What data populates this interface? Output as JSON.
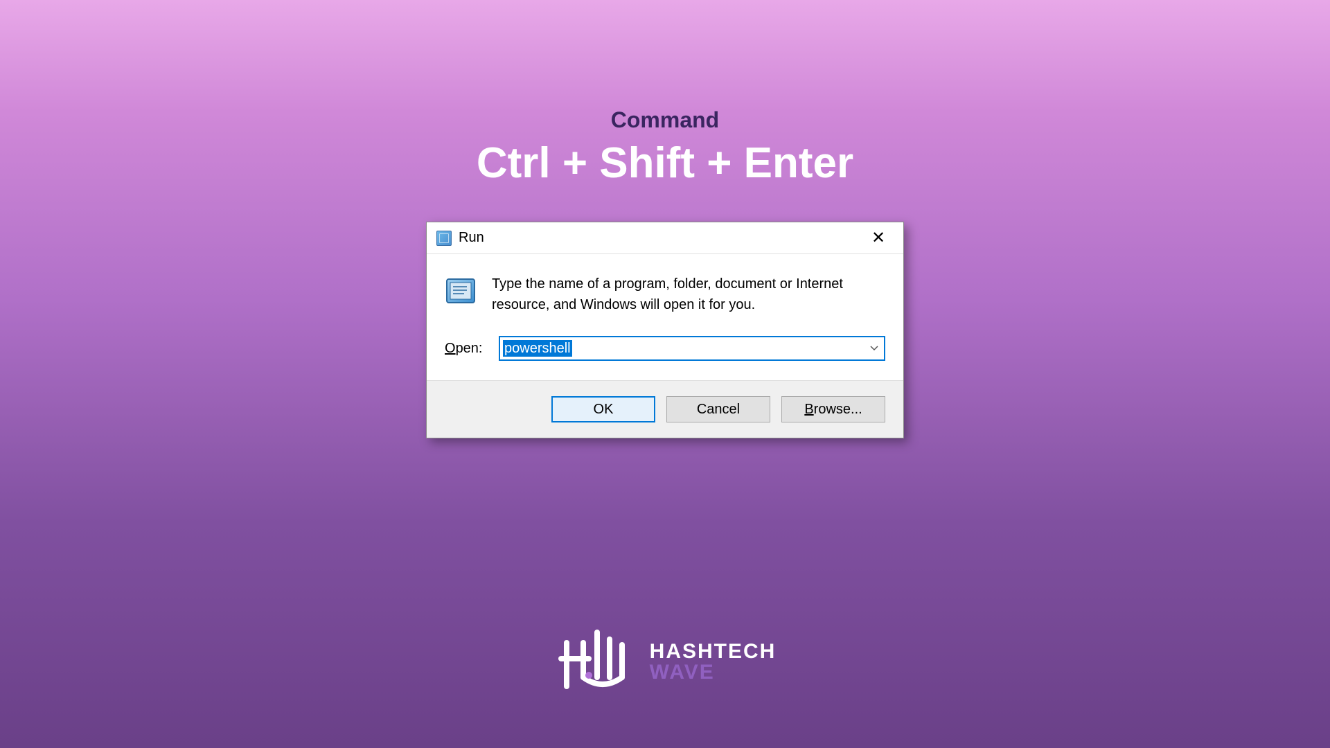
{
  "header": {
    "label": "Command",
    "keys": "Ctrl + Shift + Enter"
  },
  "dialog": {
    "title": "Run",
    "description": "Type the name of a program, folder, document or Internet resource, and Windows will open it for you.",
    "open_label_underline": "O",
    "open_label_rest": "pen:",
    "input_value": "powershell",
    "buttons": {
      "ok": "OK",
      "cancel": "Cancel",
      "browse_underline": "B",
      "browse_rest": "rowse..."
    }
  },
  "branding": {
    "line1": "HASHTECH",
    "line2": "WAVE"
  }
}
